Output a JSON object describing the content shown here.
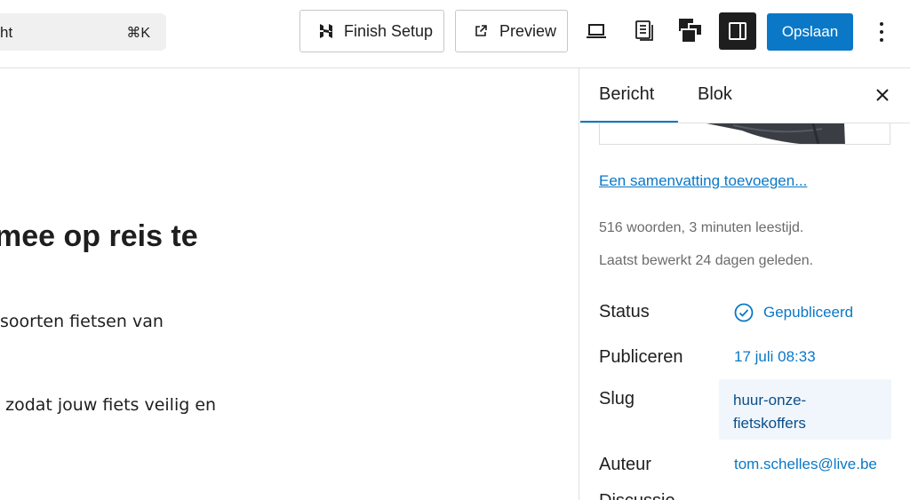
{
  "header": {
    "command_text": "ht",
    "command_shortcut": "⌘K",
    "finish_setup_label": "Finish Setup",
    "preview_label": "Preview",
    "save_label": "Opslaan"
  },
  "editor": {
    "heading_fragment": "mee op reis te",
    "para1_fragment": "soorten fietsen van",
    "para2_fragment": "zodat jouw fiets veilig en"
  },
  "sidebar": {
    "tabs": [
      "Bericht",
      "Blok"
    ],
    "active_tab": "Bericht",
    "excerpt_link": "Een samenvatting toevoegen...",
    "word_count": "516 woorden, 3 minuten leestijd.",
    "last_edited": "Laatst bewerkt 24 dagen geleden.",
    "status_label": "Status",
    "status_value": "Gepubliceerd",
    "publish_label": "Publiceren",
    "publish_value": "17 juli 08:33",
    "slug_label": "Slug",
    "slug_value": "huur-onze-fietskoffers",
    "author_label": "Auteur",
    "author_value": "tom.schelles@live.be",
    "next_label": "Discussie"
  },
  "colors": {
    "accent": "#0a78c7",
    "dark": "#1e1e1e",
    "muted": "#6b6b6b",
    "slug_bg": "#f0f6fc"
  }
}
